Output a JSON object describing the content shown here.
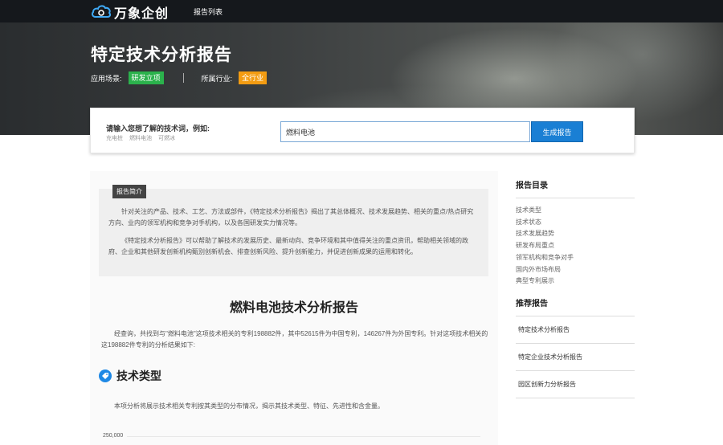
{
  "header": {
    "logo_text": "万象企创",
    "nav_item": "报告列表"
  },
  "hero": {
    "title": "特定技术分析报告",
    "scene_label": "应用场景:",
    "scene_tag": "研发立项",
    "industry_label": "所属行业:",
    "industry_tag": "全行业",
    "tag_green_color": "#2bb24c",
    "tag_orange_color": "#f39c12"
  },
  "search": {
    "label": "请输入您想了解的技术词，例如:",
    "examples": [
      "充电桩",
      "燃料电池",
      "可燃冰"
    ],
    "value": "燃料电池",
    "button_label": "生成报告",
    "button_color": "#1a7fd4"
  },
  "intro": {
    "tag": "报告简介",
    "p1": "针对关注的产品、技术、工艺、方法或部件，《特定技术分析报告》揭出了其总体概况、技术发展趋势、相关的重点/热点研究方向、业内的领军机构和竞争对手机构，以及各国研发实力情况等。",
    "p2": "《特定技术分析报告》可以帮助了解技术的发展历史、最新动向、竞争环境和其中值得关注的重点资讯，帮助相关领域的政府、企业和其他研发创新机构甄别创新机会、排查创新风险、提升创新能力，并促进创新成果的运用和转化。"
  },
  "report": {
    "title": "燃料电池技术分析报告",
    "summary": "经查询，共找到与\"燃料电池\"这项技术相关的专利198882件，其中52615件为中国专利，146267件为外国专利。针对这项技术相关的这198882件专利的分析结果如下:",
    "section_title": "技术类型",
    "section_icon": "tag-icon",
    "section_desc": "本项分析将展示技术相关专利按其类型的分布情况，揭示其技术类型、特征、先进性和含金量。",
    "axis_tick": "250,000"
  },
  "sidebar": {
    "toc_title": "报告目录",
    "toc": [
      "技术类型",
      "技术状态",
      "技术发展趋势",
      "研发布局重点",
      "领军机构和竞争对手",
      "国内外市场布局",
      "典型专利展示"
    ],
    "rec_title": "推荐报告",
    "recommended": [
      "特定技术分析报告",
      "特定企业技术分析报告",
      "园区创新力分析报告"
    ]
  }
}
